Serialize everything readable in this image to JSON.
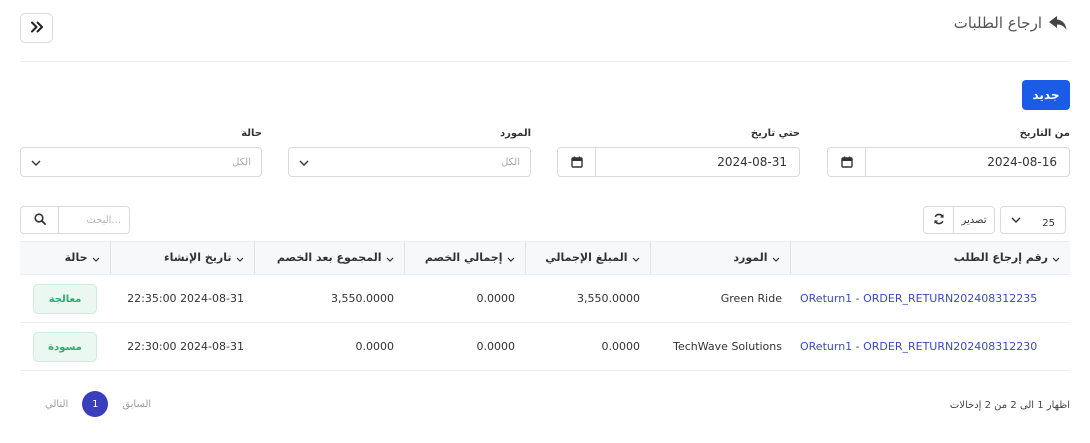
{
  "header": {
    "title": "ارجاع الطلبات",
    "back_icon": "reply-icon",
    "collapse_icon": "double-chevron-right-icon"
  },
  "actions": {
    "new_label": "جديد"
  },
  "filters": {
    "from_date": {
      "label": "من التاريخ",
      "value": "2024-08-16"
    },
    "to_date": {
      "label": "حتي تاريخ",
      "value": "2024-08-31"
    },
    "vendor": {
      "label": "المورد",
      "value": "الكل"
    },
    "status": {
      "label": "حالة",
      "value": "الكل"
    }
  },
  "toolbar": {
    "search_placeholder": "البحث...",
    "export_label": "تصدير",
    "page_size": "25"
  },
  "table": {
    "columns": [
      "رقم إرجاع الطلب",
      "المورد",
      "المبلغ الإجمالي",
      "إجمالي الخصم",
      "المجموع بعد الخصم",
      "تاريخ الإنشاء",
      "حالة"
    ],
    "rows": [
      {
        "code": "OReturn1 - ORDER_RETURN202408312235",
        "vendor": "Green Ride",
        "total": "3,550.0000",
        "discount": "0.0000",
        "net": "3,550.0000",
        "created": "2024-08-31 22:35:00",
        "status": "معالجة"
      },
      {
        "code": "OReturn1 - ORDER_RETURN202408312230",
        "vendor": "TechWave Solutions",
        "total": "0.0000",
        "discount": "0.0000",
        "net": "0.0000",
        "created": "2024-08-31 22:30:00",
        "status": "مسودة"
      }
    ]
  },
  "footer": {
    "info": "اظهار 1 الى 2 من 2 إدخالات",
    "prev": "السابق",
    "current_page": "1",
    "next": "التالي"
  },
  "colors": {
    "primary": "#1a5ce5",
    "link": "#3b4bb8",
    "pager_active": "#3a3ebd",
    "badge_text": "#27ae73",
    "badge_bg": "#eaf8f1"
  }
}
